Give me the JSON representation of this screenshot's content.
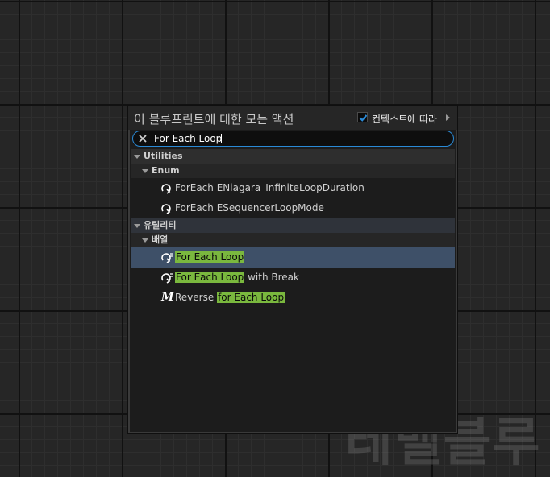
{
  "watermark": "레벨블루",
  "panel": {
    "title": "이 블루프린트에 대한 모든 액션",
    "context_label": "컨텍스트에 따라",
    "context_checked": true
  },
  "search": {
    "value": "For Each Loop"
  },
  "categories": [
    {
      "label": "Utilities",
      "sub": {
        "label": "Enum",
        "items": [
          {
            "text": "ForEach ENiagara_InfiniteLoopDuration",
            "icon": "loop-icon"
          },
          {
            "text": "ForEach ESequencerLoopMode",
            "icon": "loop-icon"
          }
        ]
      }
    },
    {
      "label": "유틸리티",
      "sub": {
        "label": "배열",
        "items": [
          {
            "pre": "",
            "match": "For Each Loop",
            "post": "",
            "icon": "loop-icon",
            "selected": true
          },
          {
            "pre": "",
            "match": "For Each Loop",
            "post": " with Break",
            "icon": "loop-icon",
            "selected": false
          },
          {
            "pre": "Reverse ",
            "match": "for Each Loop",
            "post": "",
            "icon": "macro-icon",
            "icon_glyph": "M",
            "selected": false
          }
        ]
      }
    }
  ],
  "colors": {
    "accent": "#2a8ad6",
    "highlight": "#7ab83e",
    "selected_row": "#3e5068"
  }
}
